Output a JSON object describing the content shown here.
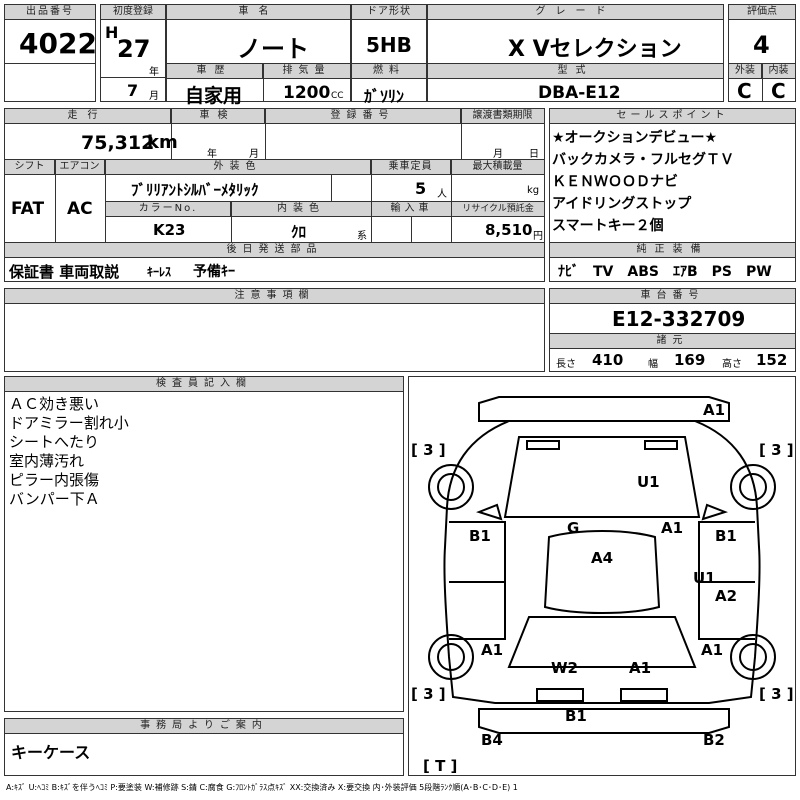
{
  "lot": {
    "label": "出品番号",
    "value": "4022"
  },
  "first_reg": {
    "label": "初度登録",
    "era": "H",
    "year": "27",
    "year_unit": "年",
    "month": "7",
    "month_unit": "月"
  },
  "car_name": {
    "label": "車名",
    "value": "ノート"
  },
  "door": {
    "label": "ドア形状",
    "value": "5HB"
  },
  "grade": {
    "label": "グレード",
    "value": "X Vセレクション"
  },
  "score": {
    "label": "評価点",
    "value": "4"
  },
  "history": {
    "label": "車歴",
    "value": "自家用"
  },
  "displacement": {
    "label": "排気量",
    "value": "1200",
    "unit": "CC"
  },
  "fuel": {
    "label": "燃料",
    "value": "ｶﾞｿﾘﾝ"
  },
  "model_code": {
    "label": "型式",
    "value": "DBA-E12"
  },
  "exterior_grade": {
    "label": "外装",
    "value": "C"
  },
  "interior_grade": {
    "label": "内装",
    "value": "C"
  },
  "mileage": {
    "label": "走行",
    "value": "75,312",
    "unit": "km"
  },
  "inspection": {
    "label": "車検",
    "year_unit": "年",
    "month_unit": "月"
  },
  "registration_no": {
    "label": "登録番号"
  },
  "transfer_deadline": {
    "label": "譲渡書類期限",
    "month_unit": "月",
    "day_unit": "日"
  },
  "shift": {
    "label": "シフト",
    "value": "FAT"
  },
  "aircon": {
    "label": "エアコン",
    "value": "AC"
  },
  "exterior_color": {
    "label": "外装色",
    "value": "ﾌﾞﾘﾘｱﾝﾄｼﾙﾊﾞｰﾒﾀﾘｯｸ"
  },
  "capacity": {
    "label": "乗車定員",
    "value": "5",
    "unit": "人"
  },
  "max_load": {
    "label": "最大積載量",
    "unit": "kg"
  },
  "color_no": {
    "label": "カラーNo.",
    "value": "K23"
  },
  "interior_color": {
    "label": "内装色",
    "value": "ｸﾛ",
    "unit": "系"
  },
  "import": {
    "label": "輸入車"
  },
  "recycle": {
    "label": "リサイクル預託金",
    "value": "8,510",
    "unit": "円"
  },
  "sales_points": {
    "label": "セールスポイント",
    "items": [
      "★オークションデビュー★",
      "バックカメラ・フルセグＴＶ",
      "ＫＥＮＷＯＯＤナビ",
      "アイドリングストップ",
      "スマートキー２個"
    ]
  },
  "later_items": {
    "label": "後日発送部品",
    "main": "保証書 車両取説",
    "small1": "ｷｰﾚｽ",
    "small2": "予備ｷｰ"
  },
  "equipment": {
    "label": "純正装備",
    "value": "ﾅﾋﾞ　TV　ABS　ｴｱB　PS　PW"
  },
  "notes": {
    "label": "注意事項欄"
  },
  "chassis": {
    "label": "車台番号",
    "value": "E12-332709"
  },
  "specs": {
    "label": "諸元",
    "length_label": "長さ",
    "length": "410",
    "width_label": "幅",
    "width": "169",
    "height_label": "高さ",
    "height": "152"
  },
  "inspector": {
    "label": "検査員記入欄",
    "lines": [
      "ＡＣ効き悪い",
      "ドアミラー割れ小",
      "シートへたり",
      "室内薄汚れ",
      "ピラー内張傷",
      "バンパー下Ａ"
    ]
  },
  "office": {
    "label": "事務局よりご案内",
    "value": "キーケース"
  },
  "diagram_marks": [
    "A1",
    "[ 3 ]",
    "[ 3 ]",
    "U1",
    "B1",
    "G",
    "A1",
    "B1",
    "A4",
    "U1",
    "A2",
    "A1",
    "W2",
    "A1",
    "A1",
    "[ 3 ]",
    "[ 3 ]",
    "B1",
    "B4",
    "B2",
    "[ T ]"
  ],
  "legend": "A:ｷｽﾞ U:ﾍｺﾐ B:ｷｽﾞを伴うﾍｺﾐ P:要塗装 W:補修跡 S:錆 C:腐食 G:ﾌﾛﾝﾄｶﾞﾗｽ点ｷｽﾞ XX:交換済み X:要交換 内･外装評価 5段階ﾗﾝｸ順(A･B･C･D･E) 1"
}
